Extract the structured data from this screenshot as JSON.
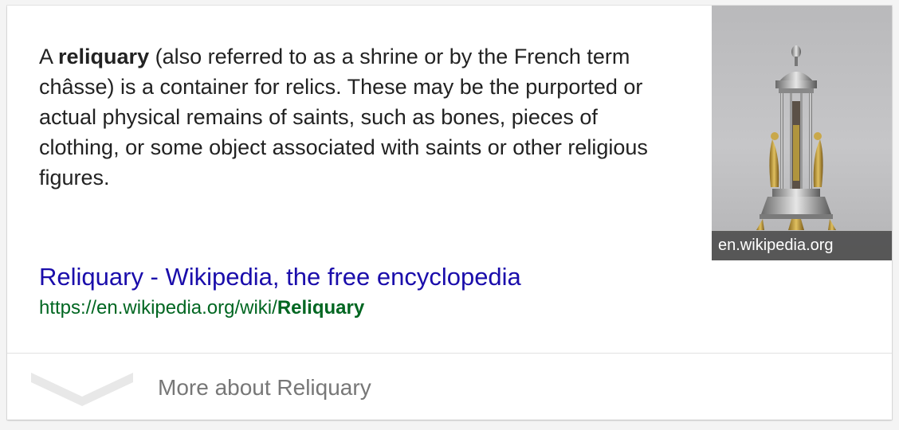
{
  "snippet": {
    "prefix": "A ",
    "term": "reliquary",
    "body": " (also referred to as a shrine or by the French term châsse) is a container for relics. These may be the purported or actual physical remains of saints, such as bones, pieces of clothing, or some object associated with saints or other religious figures."
  },
  "image": {
    "caption": "en.wikipedia.org"
  },
  "result": {
    "title": "Reliquary - Wikipedia, the free encyclopedia",
    "url_base": "https://en.wikipedia.org/wiki/",
    "url_bold": "Reliquary"
  },
  "more": {
    "label": "More about Reliquary",
    "icon": "chevron-down-icon"
  },
  "colors": {
    "link": "#1a0dab",
    "url": "#006621",
    "text": "#222222",
    "muted": "#777777"
  }
}
